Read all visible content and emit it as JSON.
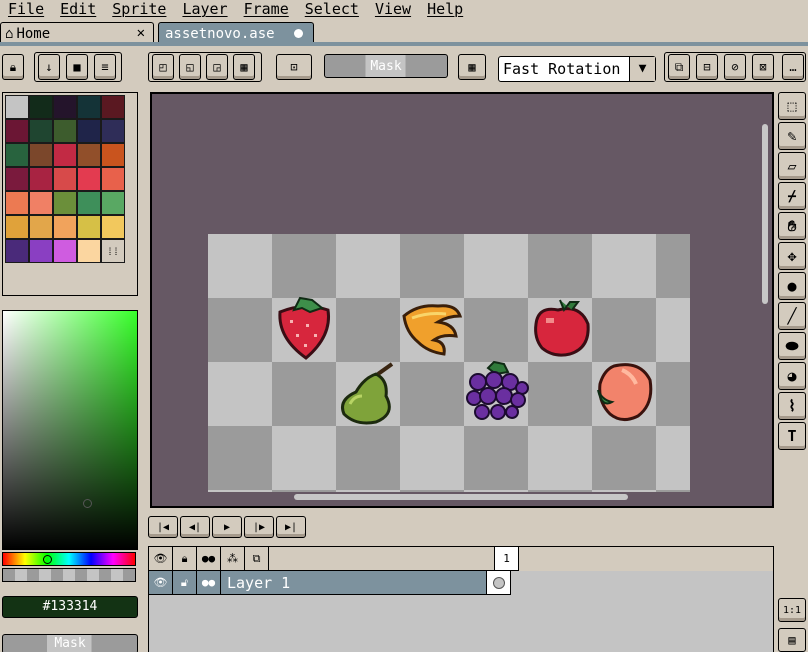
{
  "menu": [
    "File",
    "Edit",
    "Sprite",
    "Layer",
    "Frame",
    "Select",
    "View",
    "Help"
  ],
  "tabs": {
    "home_label": "Home",
    "file_label": "assetnovo.ase"
  },
  "toolbar": {
    "mask_label": "Mask",
    "rotation_algorithm": "Fast Rotation"
  },
  "palette": {
    "colors": [
      "#c4c4c4",
      "#122b1a",
      "#24142b",
      "#143337",
      "#5a1821",
      "#6b1634",
      "#1f4530",
      "#3d5c2d",
      "#1f2449",
      "#2f2d58",
      "#28633e",
      "#7b472b",
      "#c22a44",
      "#914f2a",
      "#c9541e",
      "#7a1a3d",
      "#a82342",
      "#d74a4a",
      "#e33b50",
      "#e8614b",
      "#ec7a52",
      "#f08065",
      "#6b8f3a",
      "#3e8f5a",
      "#59a863",
      "#e0a23a",
      "#e2a64a",
      "#f1a35c",
      "#d6c046",
      "#f2c85d",
      "#4a2a7a",
      "#8a3fc2",
      "#cf5ce0",
      "#fbd6a0",
      "#d3cbbe"
    ]
  },
  "color": {
    "hex": "#133314",
    "mask_label": "Mask"
  },
  "timeline": {
    "frame_number": "1",
    "layer_name": "Layer 1"
  },
  "zoom_label": "1:1"
}
